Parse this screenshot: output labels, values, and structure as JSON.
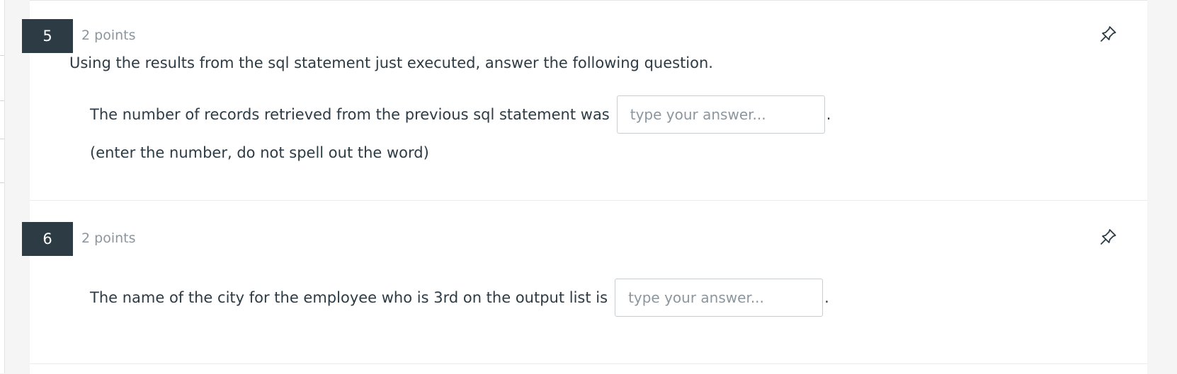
{
  "questions": [
    {
      "number": "5",
      "points": "2 points",
      "prompt": "Using the results from the sql statement just executed, answer the following question.",
      "sentence_prefix": "The number of records retrieved from the previous sql statement was",
      "answer_placeholder": "type your answer...",
      "answer_value": "",
      "sentence_suffix": ".",
      "note": "(enter the number, do not spell out the word)",
      "pin_icon": "pin-icon"
    },
    {
      "number": "6",
      "points": "2 points",
      "sentence_prefix": "The name of the city for the employee who is 3rd on the output list is",
      "answer_placeholder": "type your answer...",
      "answer_value": "",
      "sentence_suffix": ".",
      "pin_icon": "pin-icon"
    }
  ],
  "colors": {
    "number_badge_bg": "#2d3b45",
    "text": "#2d3b45",
    "muted": "#8b969e",
    "input_border": "#c7cdd1"
  }
}
